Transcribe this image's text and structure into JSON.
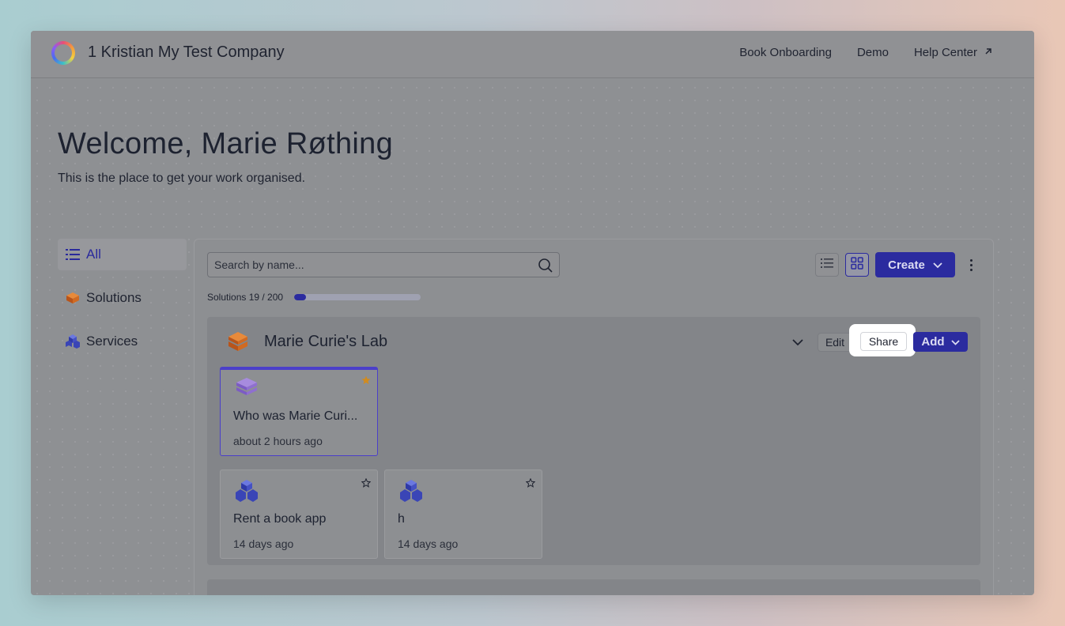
{
  "header": {
    "company": "1 Kristian My Test Company",
    "links": [
      "Book Onboarding",
      "Demo",
      "Help Center"
    ],
    "external_link_icon": "arrow-up-right-icon"
  },
  "welcome": {
    "title": "Welcome, Marie Røthing",
    "subtitle": "This is the place to get your work organised."
  },
  "sidebar": {
    "items": [
      {
        "label": "All",
        "icon": "list-icon",
        "active": true
      },
      {
        "label": "Solutions",
        "icon": "solution-layers-icon",
        "active": false
      },
      {
        "label": "Services",
        "icon": "service-cubes-icon",
        "active": false
      }
    ]
  },
  "toolbar": {
    "search_placeholder": "Search by name...",
    "usage_label": "Solutions 19 / 200",
    "usage_fraction": 0.095,
    "create_label": "Create",
    "view_mode": "grid"
  },
  "group": {
    "title": "Marie Curie's Lab",
    "edit_label": "Edit",
    "share_label": "Share",
    "add_label": "Add",
    "cards": [
      {
        "title": "Who was Marie Curi...",
        "time": "about 2 hours ago",
        "starred": true,
        "selected": true,
        "icon": "purple-layers-icon"
      },
      {
        "title": "Rent a book app",
        "time": "14 days ago",
        "starred": false,
        "selected": false,
        "icon": "service-cubes-icon"
      },
      {
        "title": "h",
        "time": "14 days ago",
        "starred": false,
        "selected": false,
        "icon": "service-cubes-icon"
      }
    ]
  },
  "colors": {
    "accent": "#2b2b9f",
    "selected_border": "#4b3fc9",
    "star": "#d18b1f"
  }
}
